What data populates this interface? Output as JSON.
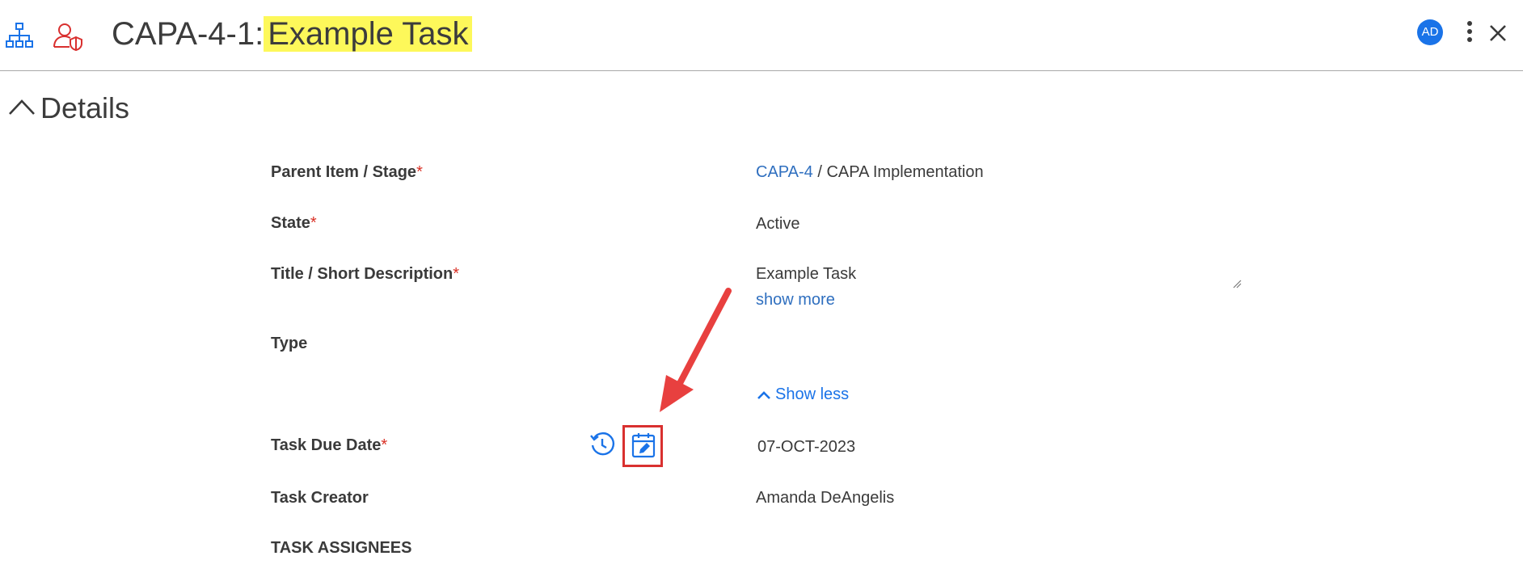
{
  "header": {
    "title_prefix": "CAPA-4-1:",
    "title_highlight": "Example Task",
    "avatar_initials": "AD",
    "icons": [
      "hierarchy-icon",
      "user-shield-icon",
      "more-vertical-icon",
      "close-icon"
    ]
  },
  "section": {
    "title": "Details",
    "expanded": true
  },
  "fields": {
    "parent": {
      "label": "Parent Item / Stage",
      "link": "CAPA-4",
      "separator": " / ",
      "value": "CAPA Implementation"
    },
    "state": {
      "label": "State",
      "value": "Active"
    },
    "title": {
      "label": "Title / Short Description",
      "value": "Example Task",
      "more": "show more"
    },
    "type": {
      "label": "Type",
      "value": ""
    },
    "show_less": "Show less",
    "due_date": {
      "label": "Task Due Date",
      "value": "07-OCT-2023"
    },
    "creator": {
      "label": "Task Creator",
      "value": "Amanda DeAngelis"
    },
    "assignees": {
      "label": "TASK ASSIGNEES"
    }
  },
  "required_marker": "*",
  "colors": {
    "accent": "#1a73e8",
    "link": "#2f6fbf",
    "required": "#d93025",
    "highlight": "#fdf85a",
    "annotation": "#e8403f"
  }
}
